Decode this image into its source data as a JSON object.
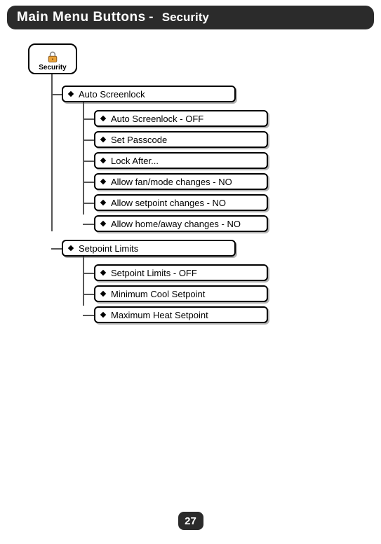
{
  "header": {
    "title": "Main Menu Buttons",
    "separator": " - ",
    "subtitle": "Security"
  },
  "root": {
    "label": "Security"
  },
  "menu": {
    "auto_screenlock": {
      "label": "Auto Screenlock",
      "children": {
        "off": "Auto Screenlock - OFF",
        "set_passcode": "Set Passcode",
        "lock_after": "Lock After...",
        "allow_fan": "Allow fan/mode changes - NO",
        "allow_setpoint": "Allow setpoint changes - NO",
        "allow_home_away": "Allow home/away changes - NO"
      }
    },
    "setpoint_limits": {
      "label": "Setpoint Limits",
      "children": {
        "off": "Setpoint Limits - OFF",
        "min_cool": "Minimum Cool Setpoint",
        "max_heat": "Maximum Heat Setpoint"
      }
    }
  },
  "page_number": "27"
}
